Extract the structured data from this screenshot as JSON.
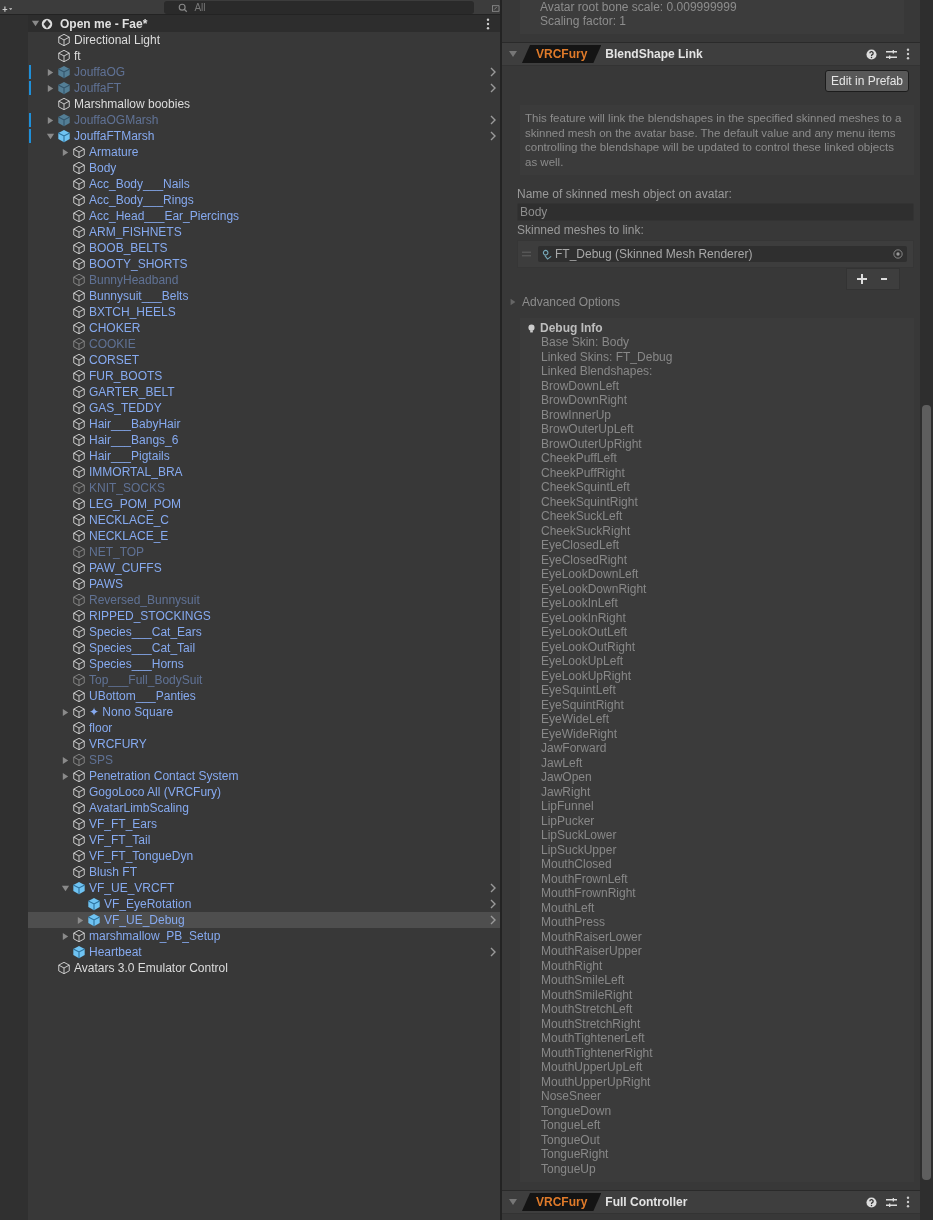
{
  "toolbar": {
    "search_placeholder": "All"
  },
  "hierarchy": {
    "root": {
      "name": "Open me - Fae*",
      "expanded": true,
      "children": [
        {
          "name": "Directional Light",
          "kind": "object",
          "active": true,
          "modified": false
        },
        {
          "name": "ft",
          "kind": "object",
          "active": true,
          "modified": false
        },
        {
          "name": "JouffaOG",
          "kind": "prefab",
          "active": false,
          "modified": true,
          "expanded": false
        },
        {
          "name": "JouffaFT",
          "kind": "prefab",
          "active": false,
          "modified": true,
          "expanded": false
        },
        {
          "name": "Marshmallow boobies",
          "kind": "object",
          "active": true,
          "modified": false
        },
        {
          "name": "JouffaOGMarsh",
          "kind": "prefab",
          "active": false,
          "modified": true,
          "expanded": false
        },
        {
          "name": "JouffaFTMarsh",
          "kind": "prefab",
          "active": true,
          "modified": true,
          "expanded": true,
          "children": [
            {
              "name": "Armature",
              "kind": "part",
              "active": true,
              "expanded": false
            },
            {
              "name": "Body",
              "kind": "part",
              "active": true
            },
            {
              "name": "Acc_Body___Nails",
              "kind": "part",
              "active": true
            },
            {
              "name": "Acc_Body___Rings",
              "kind": "part",
              "active": true
            },
            {
              "name": "Acc_Head___Ear_Piercings",
              "kind": "part",
              "active": true
            },
            {
              "name": "ARM_FISHNETS",
              "kind": "part",
              "active": true
            },
            {
              "name": "BOOB_BELTS",
              "kind": "part",
              "active": true
            },
            {
              "name": "BOOTY_SHORTS",
              "kind": "part",
              "active": true
            },
            {
              "name": "BunnyHeadband",
              "kind": "part",
              "active": false
            },
            {
              "name": "Bunnysuit___Belts",
              "kind": "part",
              "active": true
            },
            {
              "name": "BXTCH_HEELS",
              "kind": "part",
              "active": true
            },
            {
              "name": "CHOKER",
              "kind": "part",
              "active": true
            },
            {
              "name": "COOKIE",
              "kind": "part",
              "active": false
            },
            {
              "name": "CORSET",
              "kind": "part",
              "active": true
            },
            {
              "name": "FUR_BOOTS",
              "kind": "part",
              "active": true
            },
            {
              "name": "GARTER_BELT",
              "kind": "part",
              "active": true
            },
            {
              "name": "GAS_TEDDY",
              "kind": "part",
              "active": true
            },
            {
              "name": "Hair___BabyHair",
              "kind": "part",
              "active": true
            },
            {
              "name": "Hair___Bangs_6",
              "kind": "part",
              "active": true
            },
            {
              "name": "Hair___Pigtails",
              "kind": "part",
              "active": true
            },
            {
              "name": "IMMORTAL_BRA",
              "kind": "part",
              "active": true
            },
            {
              "name": "KNIT_SOCKS",
              "kind": "part",
              "active": false
            },
            {
              "name": "LEG_POM_POM",
              "kind": "part",
              "active": true
            },
            {
              "name": "NECKLACE_C",
              "kind": "part",
              "active": true
            },
            {
              "name": "NECKLACE_E",
              "kind": "part",
              "active": true
            },
            {
              "name": "NET_TOP",
              "kind": "part",
              "active": false
            },
            {
              "name": "PAW_CUFFS",
              "kind": "part",
              "active": true
            },
            {
              "name": "PAWS",
              "kind": "part",
              "active": true
            },
            {
              "name": "Reversed_Bunnysuit",
              "kind": "part",
              "active": false
            },
            {
              "name": "RIPPED_STOCKINGS",
              "kind": "part",
              "active": true
            },
            {
              "name": "Species___Cat_Ears",
              "kind": "part",
              "active": true
            },
            {
              "name": "Species___Cat_Tail",
              "kind": "part",
              "active": true
            },
            {
              "name": "Species___Horns",
              "kind": "part",
              "active": true
            },
            {
              "name": "Top___Full_BodySuit",
              "kind": "part",
              "active": false
            },
            {
              "name": "UBottom___Panties",
              "kind": "part",
              "active": true
            },
            {
              "name": "✦ Nono Square",
              "kind": "part",
              "active": true,
              "expanded": false
            },
            {
              "name": "floor",
              "kind": "part",
              "active": true
            },
            {
              "name": "VRCFURY",
              "kind": "part",
              "active": true
            },
            {
              "name": "SPS",
              "kind": "part",
              "active": false,
              "expanded": false
            },
            {
              "name": "Penetration Contact System",
              "kind": "part",
              "active": true,
              "expanded": false
            },
            {
              "name": "GogoLoco All (VRCFury)",
              "kind": "part",
              "active": true
            },
            {
              "name": "AvatarLimbScaling",
              "kind": "part",
              "active": true
            },
            {
              "name": "VF_FT_Ears",
              "kind": "part",
              "active": true
            },
            {
              "name": "VF_FT_Tail",
              "kind": "part",
              "active": true
            },
            {
              "name": "VF_FT_TongueDyn",
              "kind": "part",
              "active": true
            },
            {
              "name": "Blush FT",
              "kind": "part",
              "active": true
            },
            {
              "name": "VF_UE_VRCFT",
              "kind": "prefab",
              "active": true,
              "expanded": true,
              "children": [
                {
                  "name": "VF_EyeRotation",
                  "kind": "prefab",
                  "active": true,
                  "selected": false
                },
                {
                  "name": "VF_UE_Debug",
                  "kind": "prefab",
                  "active": true,
                  "expanded": false,
                  "selected": true
                }
              ]
            },
            {
              "name": "marshmallow_PB_Setup",
              "kind": "part",
              "active": true,
              "expanded": false
            },
            {
              "name": "Heartbeat",
              "kind": "prefab",
              "active": true
            }
          ]
        },
        {
          "name": "Avatars 3.0 Emulator Control",
          "kind": "object",
          "active": true,
          "modified": false
        }
      ]
    }
  },
  "inspector": {
    "prev_lines": [
      "Avatar root bone scale: 0.009999999",
      "Scaling factor: 1"
    ],
    "components": [
      {
        "badge": "VRCFury",
        "title": "BlendShape Link",
        "expanded": true,
        "edit_button": "Edit in Prefab",
        "description": "This feature will link the blendshapes in the specified skinned meshes to a skinned mesh on the avatar base. The default value and any menu items controlling the blendshape will be updated to control these linked objects as well.",
        "name_label": "Name of skinned mesh object on avatar:",
        "name_value": "Body",
        "list_label": "Skinned meshes to link:",
        "list_items": [
          "FT_Debug (Skinned Mesh Renderer)"
        ],
        "advanced": {
          "label": "Advanced Options",
          "expanded": false
        },
        "debug": {
          "title": "Debug Info",
          "lines": [
            "Base Skin: Body",
            "Linked Skins: FT_Debug",
            "Linked Blendshapes:",
            "BrowDownLeft",
            "BrowDownRight",
            "BrowInnerUp",
            "BrowOuterUpLeft",
            "BrowOuterUpRight",
            "CheekPuffLeft",
            "CheekPuffRight",
            "CheekSquintLeft",
            "CheekSquintRight",
            "CheekSuckLeft",
            "CheekSuckRight",
            "EyeClosedLeft",
            "EyeClosedRight",
            "EyeLookDownLeft",
            "EyeLookDownRight",
            "EyeLookInLeft",
            "EyeLookInRight",
            "EyeLookOutLeft",
            "EyeLookOutRight",
            "EyeLookUpLeft",
            "EyeLookUpRight",
            "EyeSquintLeft",
            "EyeSquintRight",
            "EyeWideLeft",
            "EyeWideRight",
            "JawForward",
            "JawLeft",
            "JawOpen",
            "JawRight",
            "LipFunnel",
            "LipPucker",
            "LipSuckLower",
            "LipSuckUpper",
            "MouthClosed",
            "MouthFrownLeft",
            "MouthFrownRight",
            "MouthLeft",
            "MouthPress",
            "MouthRaiserLower",
            "MouthRaiserUpper",
            "MouthRight",
            "MouthSmileLeft",
            "MouthSmileRight",
            "MouthStretchLeft",
            "MouthStretchRight",
            "MouthTightenerLeft",
            "MouthTightenerRight",
            "MouthUpperUpLeft",
            "MouthUpperUpRight",
            "NoseSneer",
            "TongueDown",
            "TongueLeft",
            "TongueOut",
            "TongueRight",
            "TongueUp"
          ]
        }
      },
      {
        "badge": "VRCFury",
        "title": "Full Controller",
        "expanded": true
      }
    ]
  }
}
